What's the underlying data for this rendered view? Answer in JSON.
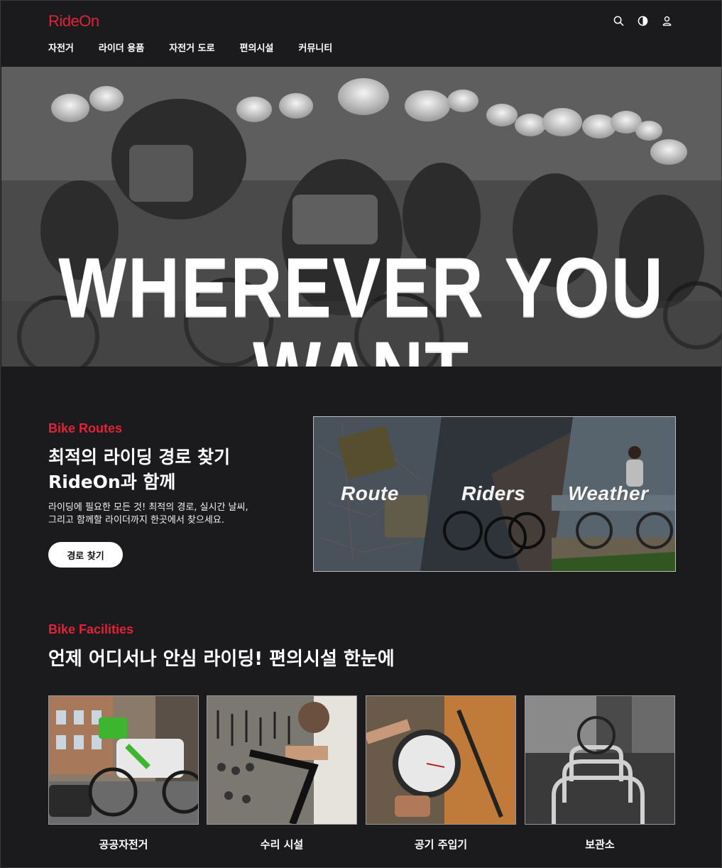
{
  "header": {
    "logo": "RideOn",
    "nav": [
      "자전거",
      "라이더 용품",
      "자전거 도로",
      "편의시설",
      "커뮤니티"
    ],
    "icons": [
      "search-icon",
      "contrast-icon",
      "user-icon"
    ]
  },
  "hero": {
    "headline": "WHEREVER YOU WANT"
  },
  "routes": {
    "eyebrow": "Bike Routes",
    "title_line1": "최적의 라이딩 경로 찾기",
    "title_line2": "RideOn과 함께",
    "desc_line1": "라이딩에 필요한 모든 것! 최적의 경로, 실시간 날씨,",
    "desc_line2": "그리고 함께할 라이더까지 한곳에서 찾으세요.",
    "button": "경로 찾기",
    "panels": [
      "Route",
      "Riders",
      "Weather"
    ]
  },
  "facilities": {
    "eyebrow": "Bike Facilities",
    "title": "언제 어디서나 안심 라이딩! 편의시설 한눈에",
    "cards": [
      "공공자전거",
      "수리 시설",
      "공기 주입기",
      "보관소"
    ]
  },
  "colors": {
    "accent": "#e0223a",
    "background": "#1b1b1d",
    "button_bg": "#ffffff"
  }
}
